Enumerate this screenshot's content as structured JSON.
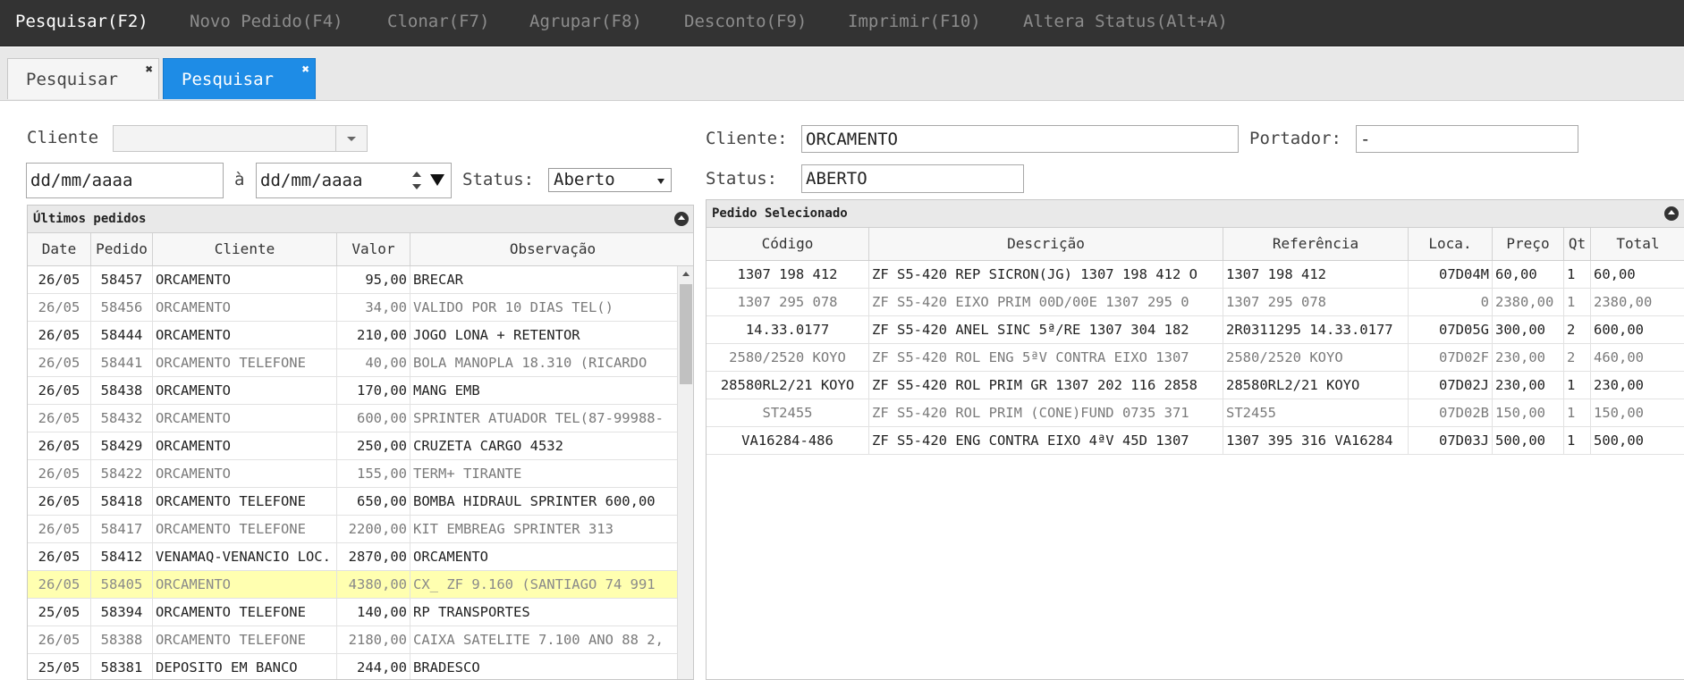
{
  "menu": [
    {
      "label": "Pesquisar(F2)",
      "active": true
    },
    {
      "label": "Novo Pedido(F4)",
      "active": false
    },
    {
      "label": "Clonar(F7)",
      "active": false
    },
    {
      "label": "Agrupar(F8)",
      "active": false
    },
    {
      "label": "Desconto(F9)",
      "active": false
    },
    {
      "label": "Imprimir(F10)",
      "active": false
    },
    {
      "label": "Altera Status(Alt+A)",
      "active": false
    }
  ],
  "tabs": [
    {
      "label": "Pesquisar",
      "close": "✖",
      "active": false
    },
    {
      "label": "Pesquisar",
      "close": "✖",
      "active": true
    }
  ],
  "filters": {
    "cliente_label": "Cliente",
    "cliente_value": "",
    "date_from": "dd/mm/aaaa",
    "date_sep": "à",
    "date_to": "dd/mm/aaaa",
    "status_label": "Status:",
    "status_value": "Aberto"
  },
  "details": {
    "cliente_label": "Cliente:",
    "cliente_value": "ORCAMENTO",
    "portador_label": "Portador:",
    "portador_value": "-",
    "status_label": "Status:",
    "status_value": "ABERTO"
  },
  "ultimos_pedidos": {
    "title": "Últimos pedidos",
    "columns": [
      "Date",
      "Pedido",
      "Cliente",
      "Valor",
      "Observação"
    ],
    "rows": [
      [
        "26/05",
        "58457",
        "ORCAMENTO",
        "95,00",
        "BRECAR"
      ],
      [
        "26/05",
        "58456",
        "ORCAMENTO",
        "34,00",
        "VALIDO POR 10 DIAS TEL()"
      ],
      [
        "26/05",
        "58444",
        "ORCAMENTO",
        "210,00",
        "JOGO LONA + RETENTOR"
      ],
      [
        "26/05",
        "58441",
        "ORCAMENTO TELEFONE",
        "40,00",
        "BOLA MANOPLA  18.310 (RICARDO"
      ],
      [
        "26/05",
        "58438",
        "ORCAMENTO",
        "170,00",
        "MANG EMB"
      ],
      [
        "26/05",
        "58432",
        "ORCAMENTO",
        "600,00",
        "SPRINTER ATUADOR TEL(87-99988-"
      ],
      [
        "26/05",
        "58429",
        "ORCAMENTO",
        "250,00",
        "CRUZETA CARGO  4532"
      ],
      [
        "26/05",
        "58422",
        "ORCAMENTO",
        "155,00",
        "TERM+ TIRANTE"
      ],
      [
        "26/05",
        "58418",
        "ORCAMENTO TELEFONE",
        "650,00",
        "BOMBA HIDRAUL SPRINTER 600,00"
      ],
      [
        "26/05",
        "58417",
        "ORCAMENTO TELEFONE",
        "2200,00",
        "KIT EMBREAG SPRINTER 313"
      ],
      [
        "26/05",
        "58412",
        "VENAMAQ-VENANCIO LOC.",
        "2870,00",
        "ORCAMENTO"
      ],
      [
        "26/05",
        "58405",
        "ORCAMENTO",
        "4380,00",
        "CX_ ZF  9.160 (SANTIAGO 74 991"
      ],
      [
        "25/05",
        "58394",
        "ORCAMENTO TELEFONE",
        "140,00",
        "RP TRANSPORTES"
      ],
      [
        "26/05",
        "58388",
        "ORCAMENTO TELEFONE",
        "2180,00",
        "CAIXA SATELITE 7.100 ANO 88 2,"
      ],
      [
        "25/05",
        "58381",
        "DEPOSITO EM BANCO",
        "244,00",
        "BRADESCO"
      ]
    ]
  },
  "pedido_selecionado": {
    "title": "Pedido Selecionado",
    "columns": [
      "Código",
      "Descrição",
      "Referência",
      "Loca.",
      "Preço",
      "Qt",
      "Total"
    ],
    "rows": [
      [
        "1307 198 412",
        "ZF S5-420 REP SICRON(JG) 1307 198 412 O",
        "1307 198 412",
        "07D04M",
        "60,00",
        "1",
        "60,00"
      ],
      [
        "1307 295 078",
        "ZF S5-420 EIXO PRIM 00D/00E 1307 295  0",
        "1307 295  078",
        "0",
        "2380,00",
        "1",
        "2380,00"
      ],
      [
        "14.33.0177",
        "ZF S5-420 ANEL SINC 5ª/RE 1307 304 182",
        "2R0311295 14.33.0177",
        "07D05G",
        "300,00",
        "2",
        "600,00"
      ],
      [
        "2580/2520 KOYO",
        "ZF S5-420 ROL ENG 5ªV CONTRA EIXO 1307",
        "2580/2520 KOYO",
        "07D02F",
        "230,00",
        "2",
        "460,00"
      ],
      [
        "28580RL2/21 KOYO",
        "ZF S5-420 ROL PRIM GR 1307 202 116 2858",
        "28580RL2/21 KOYO",
        "07D02J",
        "230,00",
        "1",
        "230,00"
      ],
      [
        "ST2455",
        "ZF S5-420 ROL PRIM (CONE)FUND 0735 371",
        "ST2455",
        "07D02B",
        "150,00",
        "1",
        "150,00"
      ],
      [
        "VA16284-486",
        "ZF S5-420 ENG CONTRA EIXO 4ªV 45D 1307",
        "1307 395 316 VA16284",
        "07D03J",
        "500,00",
        "1",
        "500,00"
      ]
    ]
  }
}
